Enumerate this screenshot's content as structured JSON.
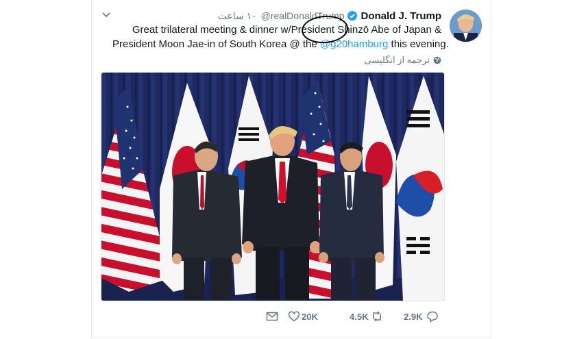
{
  "tweet": {
    "display_name": "Donald J. Trump",
    "handle": "@realDonaldTrump",
    "time": "۱۰ ساعت",
    "text_line1_before": "Great trilateral meeting & dinner w/",
    "text_line1_circled": "President",
    "text_line1_after": " Shinzō Abe of Japan &",
    "text_line2_before": "President Moon Jae-in of South Korea @ the ",
    "text_line2_mention": "@g20hamburg",
    "text_line2_after": " this evening.",
    "translate_label": "ترجمه از انگلیسی"
  },
  "actions": {
    "likes": "20K",
    "retweets": "4.5K",
    "replies": "2.9K"
  },
  "icons": {
    "caret": "chevron-down-icon",
    "verified": "verified-badge-icon",
    "globe": "globe-icon",
    "dm": "envelope-icon",
    "like": "heart-icon",
    "retweet": "retweet-icon",
    "reply": "reply-icon"
  },
  "colors": {
    "link": "#1da1f2",
    "muted": "#657786",
    "verified": "#1da1f2",
    "curtain": "#1e2a5a"
  }
}
